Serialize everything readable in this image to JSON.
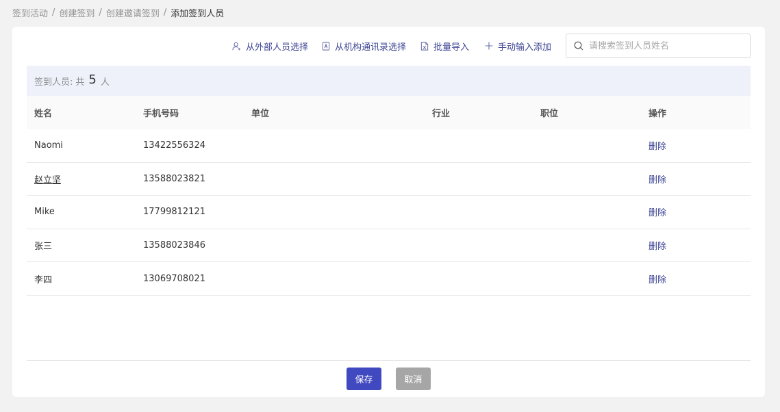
{
  "breadcrumb": [
    "签到活动",
    "创建签到",
    "创建邀请签到",
    "添加签到人员"
  ],
  "toolbar": {
    "external_select": "从外部人员选择",
    "org_select": "从机构通讯录选择",
    "batch_import": "批量导入",
    "manual_add": "手动输入添加",
    "search_placeholder": "请搜索签到人员姓名"
  },
  "summary": {
    "label": "签到人员:",
    "prefix": "共",
    "count": "5",
    "suffix": "人"
  },
  "table": {
    "columns": [
      "姓名",
      "手机号码",
      "单位",
      "行业",
      "职位",
      "操作"
    ],
    "rows": [
      {
        "name": "Naomi",
        "phone": "13422556324",
        "unit": "",
        "industry": "",
        "position": "",
        "action": "删除"
      },
      {
        "name": "赵立坚",
        "phone": "13588023821",
        "unit": "",
        "industry": "",
        "position": "",
        "action": "删除"
      },
      {
        "name": "Mike",
        "phone": "17799812121",
        "unit": "",
        "industry": "",
        "position": "",
        "action": "删除"
      },
      {
        "name": "张三",
        "phone": "13588023846",
        "unit": "",
        "industry": "",
        "position": "",
        "action": "删除"
      },
      {
        "name": "李四",
        "phone": "13069708021",
        "unit": "",
        "industry": "",
        "position": "",
        "action": "删除"
      }
    ]
  },
  "footer": {
    "save_label": "保存",
    "cancel_label": "取消"
  },
  "colors": {
    "accent": "#4149c0",
    "link": "#3d4494",
    "summary_bg": "#eef0fa",
    "cancel_bg": "#a6a6a6"
  },
  "icons": {
    "external_select": "user-add-icon",
    "org_select": "contact-book-icon",
    "batch_import": "excel-file-icon",
    "manual_add": "plus-icon",
    "search": "search-icon"
  }
}
